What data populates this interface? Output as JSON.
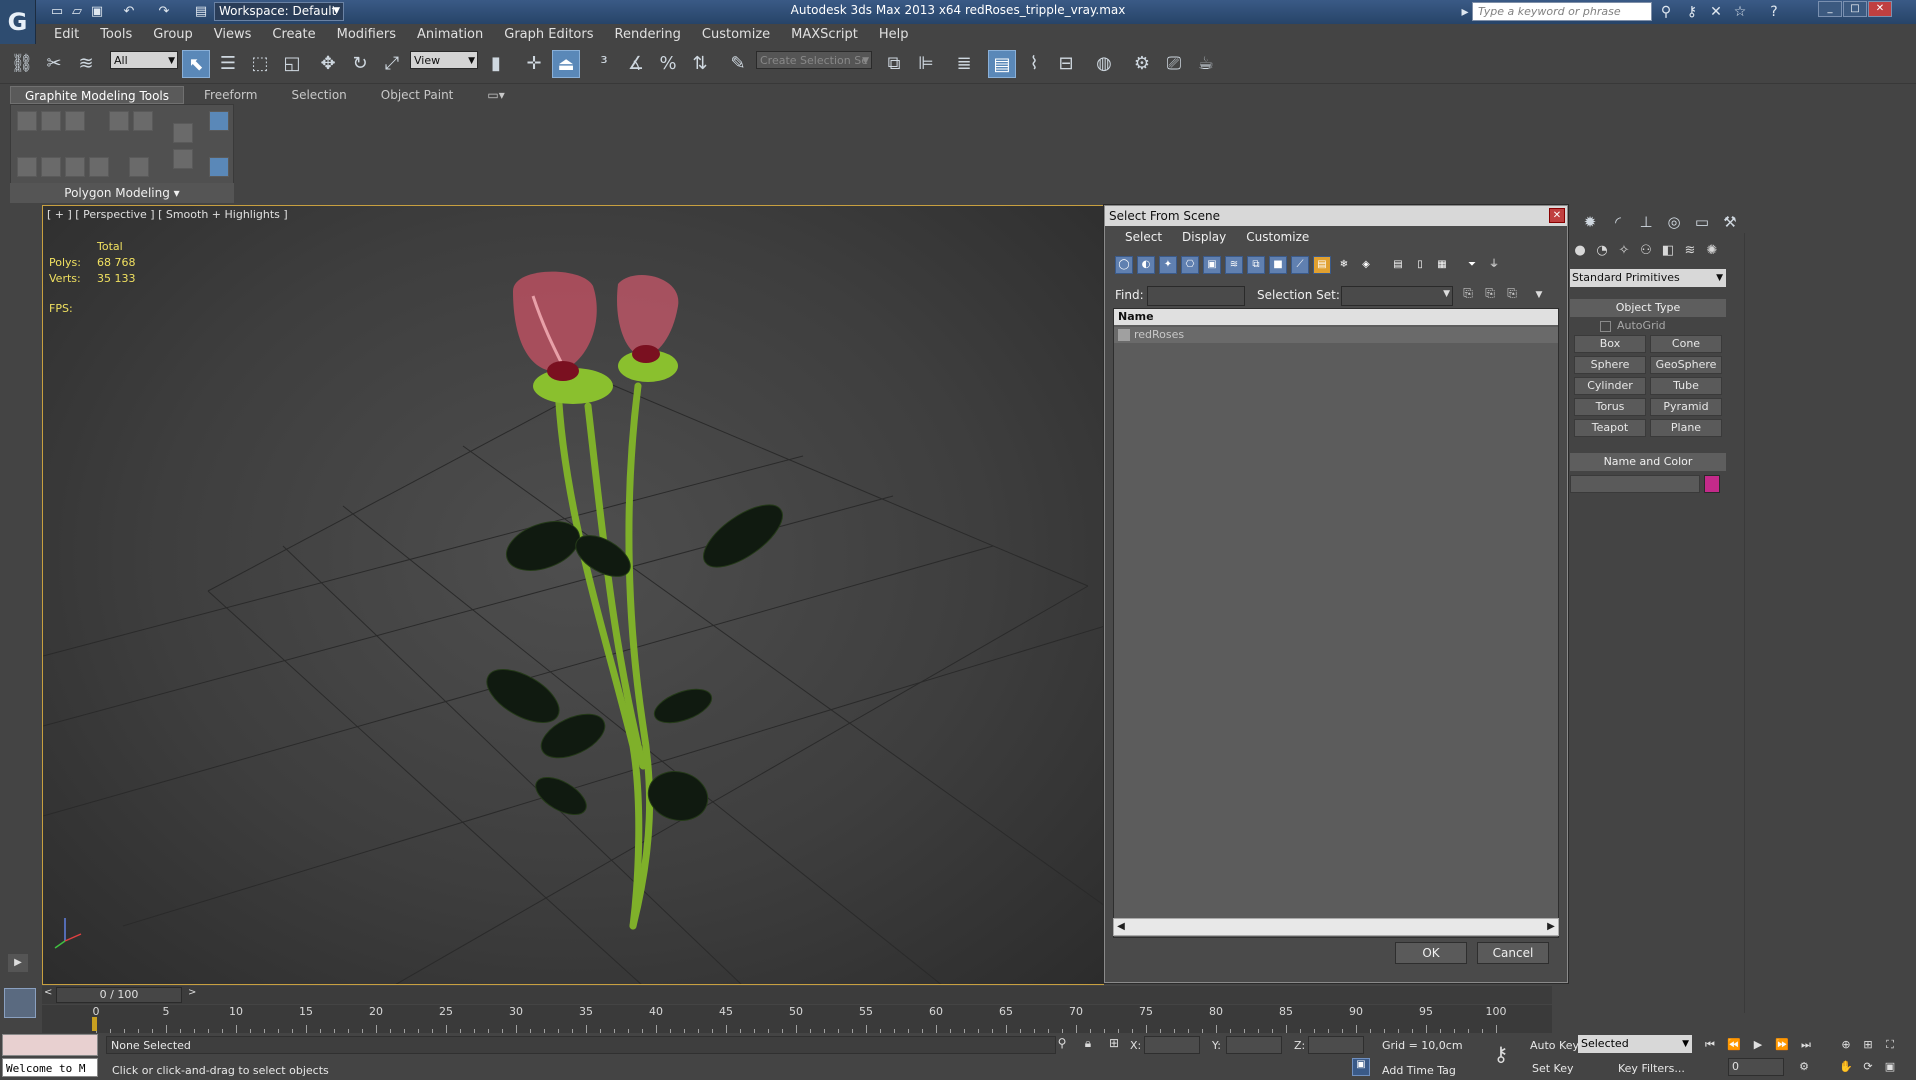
{
  "titlebar": {
    "workspace": "Workspace: Default",
    "title": "Autodesk 3ds Max  2013 x64     redRoses_tripple_vray.max",
    "search_placeholder": "Type a keyword or phrase"
  },
  "menu": [
    "Edit",
    "Tools",
    "Group",
    "Views",
    "Create",
    "Modifiers",
    "Animation",
    "Graph Editors",
    "Rendering",
    "Customize",
    "MAXScript",
    "Help"
  ],
  "toolbar": {
    "selection_filter": "All",
    "reference_coord": "View",
    "named_selection_placeholder": "Create Selection Se"
  },
  "ribbon": {
    "tabs": [
      "Graphite Modeling Tools",
      "Freeform",
      "Selection",
      "Object Paint"
    ],
    "panel_label": "Polygon Modeling"
  },
  "viewport": {
    "label": "[ + ] [ Perspective ] [ Smooth + Highlights ]",
    "stats_total": "Total",
    "polys_label": "Polys:",
    "polys_value": "68 768",
    "verts_label": "Verts:",
    "verts_value": "35 133",
    "fps_label": "FPS:"
  },
  "dialog": {
    "title": "Select From Scene",
    "menu": [
      "Select",
      "Display",
      "Customize"
    ],
    "find_label": "Find:",
    "selection_set_label": "Selection Set:",
    "column_name": "Name",
    "items": [
      "redRoses"
    ],
    "ok": "OK",
    "cancel": "Cancel"
  },
  "command_panel": {
    "category": "Standard Primitives",
    "object_type_title": "Object Type",
    "autogrid": "AutoGrid",
    "primitives": [
      "Box",
      "Cone",
      "Sphere",
      "GeoSphere",
      "Cylinder",
      "Tube",
      "Torus",
      "Pyramid",
      "Teapot",
      "Plane"
    ],
    "name_color_title": "Name and Color",
    "object_color": "#c42a8a"
  },
  "timeline": {
    "position": "0 / 100",
    "ticks": [
      "0",
      "5",
      "10",
      "15",
      "20",
      "25",
      "30",
      "35",
      "40",
      "45",
      "50",
      "55",
      "60",
      "65",
      "70",
      "75",
      "80",
      "85",
      "90",
      "95",
      "100"
    ]
  },
  "status": {
    "selection": "None Selected",
    "prompt": "Click or click-and-drag to select objects",
    "welcome": "Welcome to M",
    "x_label": "X:",
    "y_label": "Y:",
    "z_label": "Z:",
    "grid": "Grid = 10,0cm",
    "add_time_tag": "Add Time Tag",
    "auto_key": "Auto Key",
    "set_key": "Set Key",
    "key_mode": "Selected",
    "key_filters": "Key Filters...",
    "current_frame": "0"
  }
}
